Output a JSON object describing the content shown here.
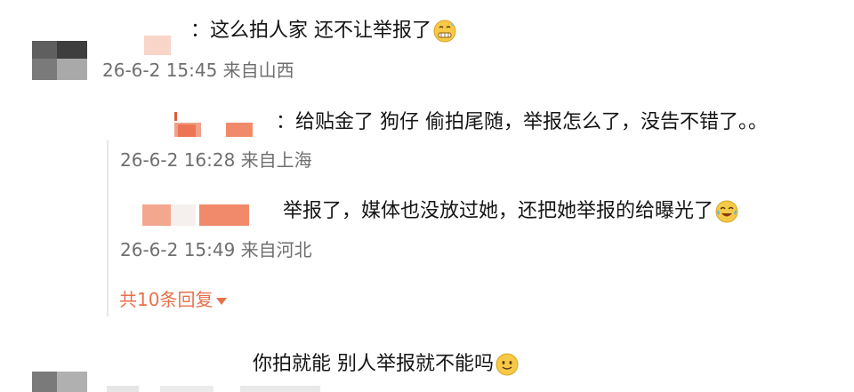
{
  "comments": [
    {
      "text": "：这么拍人家 还不让举报了",
      "meta": "26-6-2 15:45 来自山西",
      "emoji": "grimace-sweat-emoji"
    },
    {
      "text": "：给贴金了 狗仔 偷拍尾随，举报怎么了，没告不错了。。",
      "meta": "26-6-2 16:28 来自上海"
    },
    {
      "text": "举报了，媒体也没放过她，还把她举报的给曝光了",
      "meta": "26-6-2 15:49 来自河北",
      "emoji": "crying-laughing-emoji"
    },
    {
      "text": "你拍就能 别人举报就不能吗",
      "emoji": "smile-emoji"
    }
  ],
  "more_replies": {
    "label": "共10条回复"
  },
  "colors": {
    "accent": "#e8704a",
    "meta_gray": "#6f6f6f",
    "mosaic_orange": "#f08a6a",
    "mosaic_pink": "#f7c8bb"
  }
}
